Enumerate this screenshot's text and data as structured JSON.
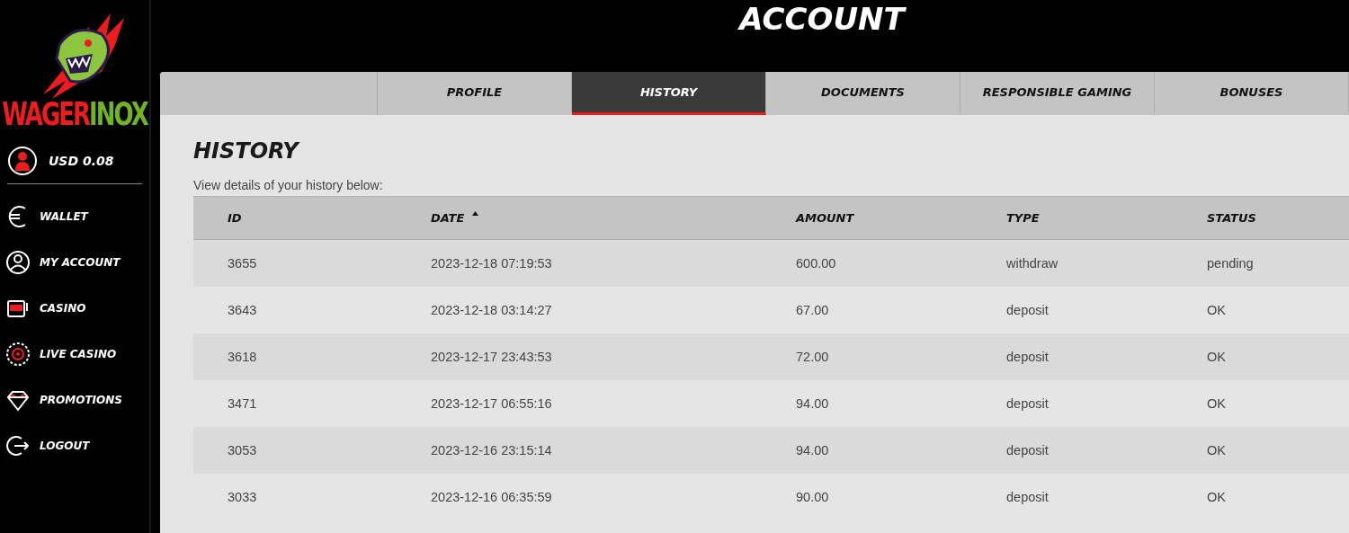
{
  "logo": {
    "parts": [
      {
        "text": "WAGER",
        "color": "#ee1c1c"
      },
      {
        "text": "INOX",
        "color": "#6fb422"
      }
    ]
  },
  "balance": "USD 0.08",
  "sidebar": {
    "items": [
      {
        "label": "WALLET"
      },
      {
        "label": "MY ACCOUNT"
      },
      {
        "label": "CASINO"
      },
      {
        "label": "LIVE CASINO"
      },
      {
        "label": "PROMOTIONS"
      },
      {
        "label": "LOGOUT"
      }
    ]
  },
  "page_title": "ACCOUNT",
  "tabs": [
    {
      "label": "PROFILE",
      "selected": false
    },
    {
      "label": "HISTORY",
      "selected": true
    },
    {
      "label": "DOCUMENTS",
      "selected": false
    },
    {
      "label": "RESPONSIBLE GAMING",
      "selected": false
    },
    {
      "label": "BONUSES",
      "selected": false
    }
  ],
  "section": {
    "title": "HISTORY",
    "description": "View details of your history below:"
  },
  "table": {
    "columns": [
      {
        "label": "ID",
        "sorted": false
      },
      {
        "label": "DATE",
        "sorted": true
      },
      {
        "label": "AMOUNT",
        "sorted": false
      },
      {
        "label": "TYPE",
        "sorted": false
      },
      {
        "label": "STATUS",
        "sorted": false
      }
    ],
    "rows": [
      [
        "3655",
        "2023-12-18 07:19:53",
        "600.00",
        "withdraw",
        "pending"
      ],
      [
        "3643",
        "2023-12-18 03:14:27",
        "67.00",
        "deposit",
        "OK"
      ],
      [
        "3618",
        "2023-12-17 23:43:53",
        "72.00",
        "deposit",
        "OK"
      ],
      [
        "3471",
        "2023-12-17 06:55:16",
        "94.00",
        "deposit",
        "OK"
      ],
      [
        "3053",
        "2023-12-16 23:15:14",
        "94.00",
        "deposit",
        "OK"
      ],
      [
        "3033",
        "2023-12-16 06:35:59",
        "90.00",
        "deposit",
        "OK"
      ]
    ]
  }
}
